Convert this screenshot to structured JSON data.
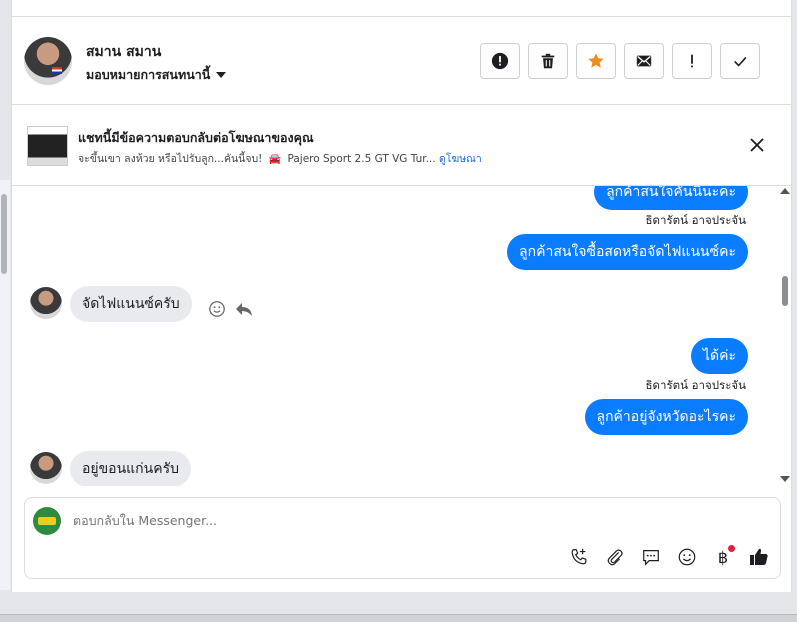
{
  "header": {
    "contact_name": "สมาน สมาน",
    "assign_label": "มอบหมายการสนทนานี้"
  },
  "actions": [
    "report-icon",
    "trash-icon",
    "star-icon",
    "mail-icon",
    "important-icon",
    "check-icon"
  ],
  "colors": {
    "accent": "#0a7cff",
    "star": "#f28b1e",
    "incoming_bubble": "#e9eaed"
  },
  "ad_banner": {
    "title": "แชทนี้มีข้อความตอบกลับต่อโฆษณาของคุณ",
    "subtitle": "จะขึ้นเขา ลงห้วย หรือไปรับลูก...คันนี้จบ!",
    "subtitle_tail": "Pajero Sport 2.5 GT VG Tur...",
    "link": "ดูโฆษณา"
  },
  "messages": [
    {
      "dir": "out",
      "text": "ลูกค้าสนใจคันนี้นะคะ"
    },
    {
      "dir": "out",
      "sender": "ธิดารัตน์ อาจประจัน",
      "text": "ลูกค้าสนใจซื้อสดหรือจัดไฟแนนซ์คะ"
    },
    {
      "dir": "in",
      "text": "จัดไฟแนนซ์ครับ"
    },
    {
      "dir": "out",
      "text": "ได้ค่ะ"
    },
    {
      "dir": "out",
      "sender": "ธิดารัตน์ อาจประจัน",
      "text": "ลูกค้าอยู่จังหวัดอะไรคะ"
    },
    {
      "dir": "in",
      "text": "อยู่ขอนแก่นครับ"
    }
  ],
  "composer": {
    "placeholder": "ตอบกลับใน Messenger..."
  }
}
